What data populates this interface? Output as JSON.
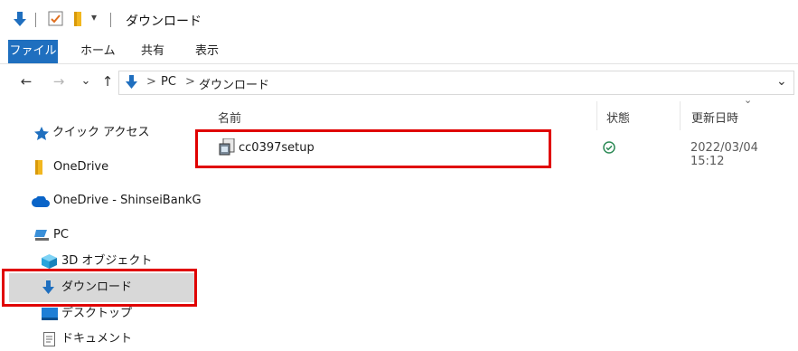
{
  "title_bar": {
    "title": "ダウンロード",
    "qa_dropdown_glyph": "▾"
  },
  "ribbon": {
    "tabs": [
      {
        "label": "ファイル",
        "active": true
      },
      {
        "label": "ホーム"
      },
      {
        "label": "共有"
      },
      {
        "label": "表示"
      }
    ]
  },
  "nav": {
    "back_glyph": "←",
    "forward_glyph": "→",
    "recent_glyph": "⌄",
    "up_glyph": "↑",
    "breadcrumb": [
      "PC",
      "ダウンロード"
    ],
    "separator": ">",
    "dropdown_glyph": "⌄"
  },
  "sidebar": {
    "items": [
      {
        "label": "クイック アクセス",
        "icon": "star-icon"
      },
      {
        "label": "OneDrive",
        "icon": "folder-icon"
      },
      {
        "label": "OneDrive - ShinseiBankG",
        "icon": "cloud-icon"
      },
      {
        "label": "PC",
        "icon": "pc-icon"
      },
      {
        "label": "3D オブジェクト",
        "icon": "cube-icon"
      },
      {
        "label": "ダウンロード",
        "icon": "download-icon",
        "selected": true
      },
      {
        "label": "デスクトップ",
        "icon": "desktop-icon"
      },
      {
        "label": "ドキュメント",
        "icon": "document-icon"
      }
    ]
  },
  "file_list": {
    "columns": {
      "name": "名前",
      "status": "状態",
      "modified": "更新日時"
    },
    "sort_glyph": "⌄",
    "rows": [
      {
        "name": "cc0397setup",
        "status": "synced",
        "modified": "2022/03/04 15:12"
      }
    ]
  },
  "colors": {
    "accent": "#1f6fbf",
    "highlight": "#e00000",
    "selection": "#d8d8d8",
    "status_ok": "#2e8b57"
  }
}
